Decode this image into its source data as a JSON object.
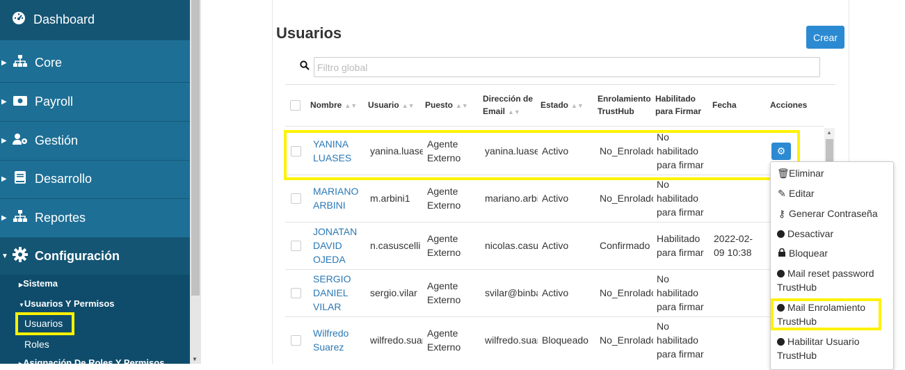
{
  "sidebar": {
    "items": [
      {
        "label": "Dashboard",
        "icon": "dashboard-icon"
      },
      {
        "label": "Core",
        "icon": "sitemap-icon"
      },
      {
        "label": "Payroll",
        "icon": "money-icon"
      },
      {
        "label": "Gestión",
        "icon": "user-gear-icon"
      },
      {
        "label": "Desarrollo",
        "icon": "book-icon"
      },
      {
        "label": "Reportes",
        "icon": "sitemap-icon"
      },
      {
        "label": "Configuración",
        "icon": "gear-icon"
      }
    ],
    "sub": {
      "sistema": "Sistema",
      "usuarios_permisos": "Usuarios Y Permisos",
      "usuarios": "Usuarios",
      "roles": "Roles",
      "asignacion": "Asignación De Roles Y Permisos"
    }
  },
  "main": {
    "title": "Usuarios",
    "create_label": "Crear",
    "filter_placeholder": "Filtro global",
    "columns": [
      "Nombre",
      "Usuario",
      "Puesto",
      "Dirección de Email",
      "Estado",
      "Enrolamiento TrustHub",
      "Habilitado para Firmar",
      "Fecha",
      "Acciones"
    ],
    "rows": [
      {
        "nombre": [
          "YANINA",
          "LUASES"
        ],
        "usuario": "yanina.luases",
        "puesto": [
          "Agente",
          "Externo"
        ],
        "email": "yanina.luases",
        "estado": "Activo",
        "enrol": "No_Enrolado",
        "firmar": [
          "No",
          "habilitado",
          "para firmar"
        ],
        "fecha": [
          "",
          ""
        ]
      },
      {
        "nombre": [
          "MARIANO",
          "ARBINI"
        ],
        "usuario": "m.arbini1",
        "puesto": [
          "Agente",
          "Externo"
        ],
        "email": "mariano.arbini",
        "estado": "Activo",
        "enrol": "No_Enrolado",
        "firmar": [
          "No",
          "habilitado",
          "para firmar"
        ],
        "fecha": [
          "",
          ""
        ]
      },
      {
        "nombre": [
          "JONATAN",
          "DAVID",
          "OJEDA"
        ],
        "usuario": "n.casuscelli",
        "puesto": [
          "Agente",
          "Externo"
        ],
        "email": "nicolas.casuscelli",
        "estado": "Activo",
        "enrol": "Confirmado",
        "firmar": [
          "Habilitado",
          "para firmar",
          ""
        ],
        "fecha": [
          "2022-02-",
          "09 10:38"
        ]
      },
      {
        "nombre": [
          "SERGIO",
          "DANIEL",
          "VILAR"
        ],
        "usuario": "sergio.vilar",
        "puesto": [
          "Agente",
          "Externo"
        ],
        "email": "svilar@binbank",
        "estado": "Activo",
        "enrol": "No_Enrolado",
        "firmar": [
          "No",
          "habilitado",
          "para firmar"
        ],
        "fecha": [
          "",
          ""
        ]
      },
      {
        "nombre": [
          "Wilfredo",
          "Suarez"
        ],
        "usuario": "wilfredo.suarez",
        "puesto": [
          "Agente",
          "Externo"
        ],
        "email": "wilfredo.suarez",
        "estado": "Bloqueado",
        "enrol": "No_Enrolado",
        "firmar": [
          "No",
          "habilitado",
          "para firmar"
        ],
        "fecha": [
          "",
          ""
        ]
      }
    ],
    "actions_menu": [
      "Eliminar",
      "Editar",
      "Generar Contraseña",
      "Desactivar",
      "Bloquear",
      "Mail reset password TrustHub",
      "Mail Enrolamiento TrustHub",
      "Habilitar Usuario TrustHub"
    ]
  },
  "colors": {
    "sidebar": "#1d6f95",
    "accent": "#2b8ad2",
    "highlight": "#fff200",
    "link": "#2a78b5"
  }
}
